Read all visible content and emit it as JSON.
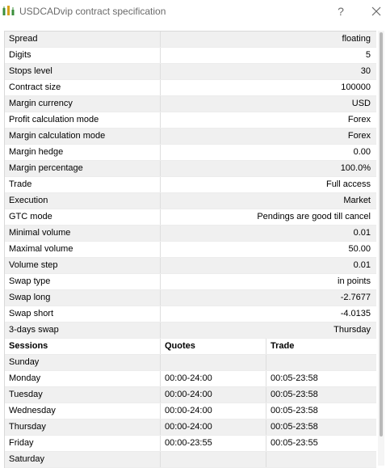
{
  "window": {
    "title": "USDCADvip contract specification",
    "help_label": "?",
    "icons": {
      "app": "chart-app-icon",
      "help": "help-icon",
      "close": "close-icon"
    }
  },
  "spec": [
    {
      "label": "Spread",
      "value": "floating"
    },
    {
      "label": "Digits",
      "value": "5"
    },
    {
      "label": "Stops level",
      "value": "30"
    },
    {
      "label": "Contract size",
      "value": "100000"
    },
    {
      "label": "Margin currency",
      "value": "USD"
    },
    {
      "label": "Profit calculation mode",
      "value": "Forex"
    },
    {
      "label": "Margin calculation mode",
      "value": "Forex"
    },
    {
      "label": "Margin hedge",
      "value": "0.00"
    },
    {
      "label": "Margin percentage",
      "value": "100.0%"
    },
    {
      "label": "Trade",
      "value": "Full access"
    },
    {
      "label": "Execution",
      "value": "Market"
    },
    {
      "label": "GTC mode",
      "value": "Pendings are good till cancel"
    },
    {
      "label": "Minimal volume",
      "value": "0.01"
    },
    {
      "label": "Maximal volume",
      "value": "50.00"
    },
    {
      "label": "Volume step",
      "value": "0.01"
    },
    {
      "label": "Swap type",
      "value": "in points"
    },
    {
      "label": "Swap long",
      "value": "-2.7677"
    },
    {
      "label": "Swap short",
      "value": "-4.0135"
    },
    {
      "label": "3-days swap",
      "value": "Thursday"
    }
  ],
  "sessions": {
    "headers": {
      "day": "Sessions",
      "quotes": "Quotes",
      "trade": "Trade"
    },
    "rows": [
      {
        "day": "Sunday",
        "quotes": "",
        "trade": ""
      },
      {
        "day": "Monday",
        "quotes": "00:00-24:00",
        "trade": "00:05-23:58"
      },
      {
        "day": "Tuesday",
        "quotes": "00:00-24:00",
        "trade": "00:05-23:58"
      },
      {
        "day": "Wednesday",
        "quotes": "00:00-24:00",
        "trade": "00:05-23:58"
      },
      {
        "day": "Thursday",
        "quotes": "00:00-24:00",
        "trade": "00:05-23:58"
      },
      {
        "day": "Friday",
        "quotes": "00:00-23:55",
        "trade": "00:05-23:55"
      },
      {
        "day": "Saturday",
        "quotes": "",
        "trade": ""
      }
    ]
  },
  "colors": {
    "row_alt": "#f0f0f0",
    "row_base": "#ffffff",
    "title_text": "#6a6a6a"
  }
}
